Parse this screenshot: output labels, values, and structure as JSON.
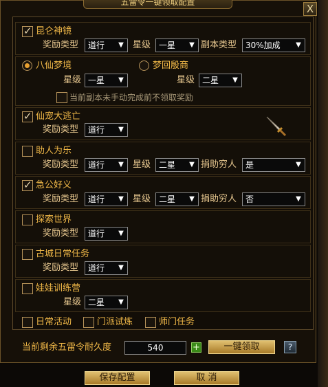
{
  "window": {
    "title": "五雷令一键领取配置",
    "close_label": "X"
  },
  "reward_options": {
    "mode_label": "奖励类型",
    "star_label": "星级",
    "dungeon_type_label": "副本类型",
    "donate_label": "捐助穷人"
  },
  "sections": {
    "kunlun": {
      "label": "昆仑神镜",
      "checked": true,
      "reward": "道行",
      "star": "一星",
      "dungeon_type": "30%加成"
    },
    "dream": {
      "opt1_label": "八仙梦境",
      "opt1_selected": true,
      "opt1_star": "一星",
      "opt2_label": "梦回殷商",
      "opt2_selected": false,
      "opt2_star": "二星",
      "note_label": "当前副本未手动完成前不领取奖励",
      "note_checked": false
    },
    "pet": {
      "label": "仙宠大逃亡",
      "checked": true,
      "reward": "道行"
    },
    "helper": {
      "label": "助人为乐",
      "checked": false,
      "reward": "道行",
      "star": "二星",
      "donate": "是"
    },
    "urgent": {
      "label": "急公好义",
      "checked": true,
      "reward": "道行",
      "star": "二星",
      "donate": "否"
    },
    "explore": {
      "label": "探索世界",
      "checked": false,
      "reward": "道行"
    },
    "ancient": {
      "label": "古城日常任务",
      "checked": false,
      "reward": "道行"
    },
    "doll": {
      "label": "娃娃训练营",
      "checked": false,
      "star": "二星"
    }
  },
  "extras": {
    "daily": {
      "label": "日常活动",
      "checked": false
    },
    "school": {
      "label": "门派试炼",
      "checked": false
    },
    "master": {
      "label": "师门任务",
      "checked": false
    }
  },
  "durability": {
    "label": "当前剩余五雷令耐久度",
    "value": "540",
    "plus_label": "+",
    "claim_label": "一键领取",
    "help_label": "?"
  },
  "footer": {
    "save_label": "保存配置",
    "cancel_label": "取 消"
  },
  "colors": {
    "accent": "#f0b848",
    "panel_bg": "#140f08",
    "border": "#5e4a2a",
    "button_gold": "#d0a850"
  }
}
